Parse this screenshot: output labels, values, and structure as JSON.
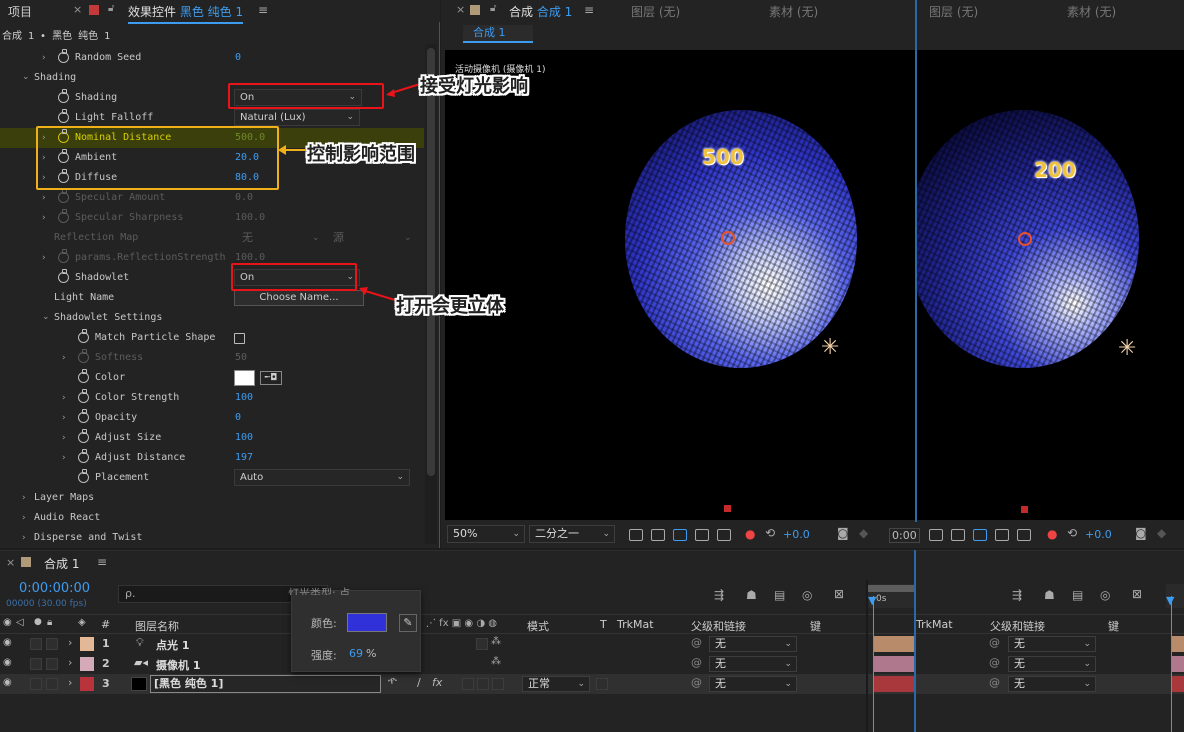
{
  "panels": {
    "project_tab": "项目",
    "effect_tab_prefix": "效果控件",
    "effect_tab_layer": "黑色 纯色 1",
    "effect_tab_menu": "≡",
    "comp_tab_prefix": "合成",
    "comp_tab_name": "合成 1",
    "comp_tab_menu": "≡",
    "layer_tab": "图层 (无)",
    "footage_tab": "素材 (无)",
    "layer_tab2": "图层 (无)",
    "footage_tab2": "素材 (无)"
  },
  "effects": {
    "breadcrumb": "合成 1 • 黑色 纯色 1",
    "rows": [
      {
        "label": "Random Seed",
        "value": "0"
      },
      {
        "label": "Shading",
        "value": ""
      },
      {
        "label": "Shading",
        "value": "On"
      },
      {
        "label": "Light Falloff",
        "value": "Natural (Lux)"
      },
      {
        "label": "Nominal Distance",
        "value": "500.0"
      },
      {
        "label": "Ambient",
        "value": "20.0"
      },
      {
        "label": "Diffuse",
        "value": "80.0"
      },
      {
        "label": "Specular Amount",
        "value": "0.0"
      },
      {
        "label": "Specular Sharpness",
        "value": "100.0"
      },
      {
        "label": "Reflection Map",
        "value": "无"
      },
      {
        "label": "params.ReflectionStrength",
        "value": "100.0"
      },
      {
        "label": "Shadowlet",
        "value": "On"
      },
      {
        "label": "Light Name",
        "value": "Choose Name..."
      },
      {
        "label": "Shadowlet Settings",
        "value": ""
      },
      {
        "label": "Match Particle Shape",
        "value": ""
      },
      {
        "label": "Softness",
        "value": "50"
      },
      {
        "label": "Color",
        "value": ""
      },
      {
        "label": "Color Strength",
        "value": "100"
      },
      {
        "label": "Opacity",
        "value": "0"
      },
      {
        "label": "Adjust Size",
        "value": "100"
      },
      {
        "label": "Adjust Distance",
        "value": "197"
      },
      {
        "label": "Placement",
        "value": "Auto"
      },
      {
        "label": "Layer Maps",
        "value": ""
      },
      {
        "label": "Audio React",
        "value": ""
      },
      {
        "label": "Disperse and Twist",
        "value": ""
      }
    ],
    "reflection_source": "源",
    "color_swatch": "#ffffff"
  },
  "viewer": {
    "subtab": "合成 1",
    "camera_label": "活动摄像机 (摄像机 1)",
    "num_left": "500",
    "num_right": "200",
    "zoom": "50%",
    "resolution": "二分之一",
    "exposure": "+0.0",
    "exposure2": "+0.0",
    "time_short": "0:00"
  },
  "annotations": {
    "accept_light": "接受灯光影响",
    "control_range": "控制影响范围",
    "more_3d": "打开会更立体"
  },
  "timeline": {
    "tab": "合成 1",
    "menu": "≡",
    "timecode": "0:00:00:00",
    "fps": "00000 (30.00 fps)",
    "search_placeholder": "ρ.",
    "hidden_label": "灯光类型:",
    "hidden_value": "点",
    "headers": {
      "num": "#",
      "name": "图层名称",
      "mode": "模式",
      "t": "T",
      "trkmat": "TrkMat",
      "parent": "父级和链接",
      "keys": "键",
      "trkmat2": "TrkMat",
      "parent2": "父级和链接",
      "keys2": "键"
    },
    "ruler_label": "0s",
    "layers": [
      {
        "num": "1",
        "name": "点光 1",
        "color": "#e3b896",
        "mode": "",
        "parent": "无"
      },
      {
        "num": "2",
        "name": "摄像机 1",
        "color": "#d4a9b8",
        "mode": "",
        "parent": "无"
      },
      {
        "num": "3",
        "name": "[黑色 纯色 1]",
        "color": "#b8343a",
        "mode": "正常",
        "parent": "无"
      }
    ],
    "popup": {
      "color_label": "颜色:",
      "color_value": "#3031d8",
      "strength_label": "强度:",
      "strength_value": "69",
      "strength_unit": "%"
    }
  }
}
